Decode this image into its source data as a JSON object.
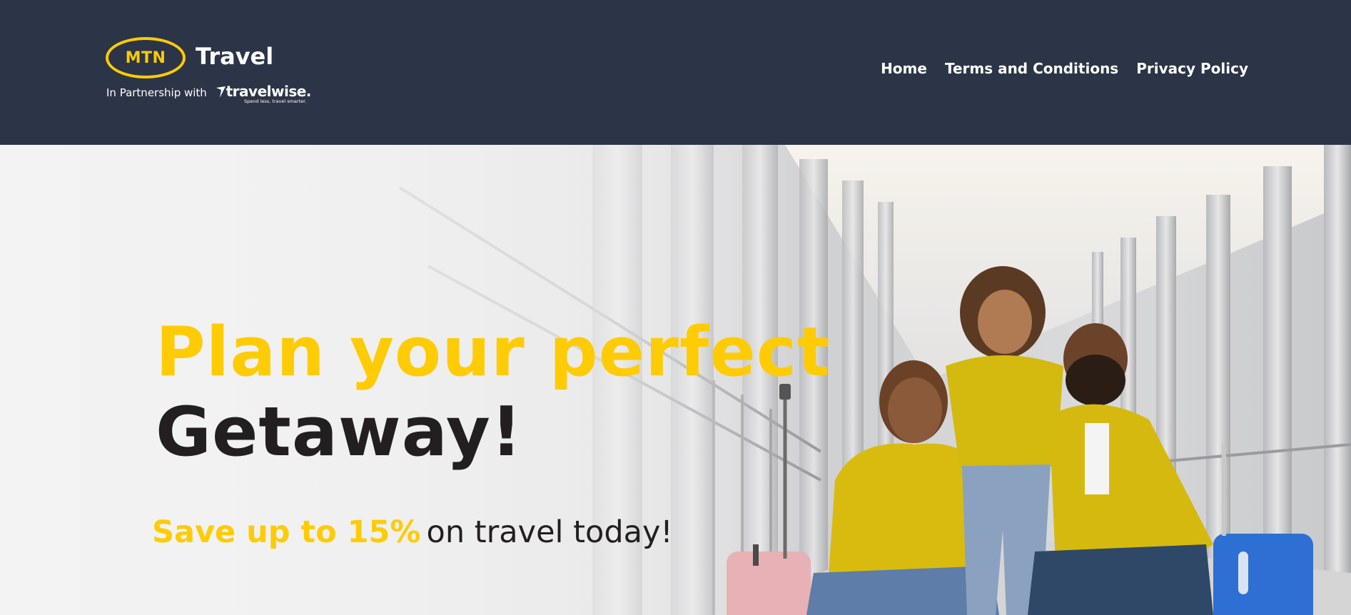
{
  "brand": {
    "mtn_mark": "MTN",
    "product_name": "Travel",
    "partnership_text": "In Partnership with",
    "partner_name": "travelwise.",
    "partner_tagline": "Spend less, travel smarter.",
    "colors": {
      "header_bg": "#2b3547",
      "mtn_yellow": "#ffcb05",
      "text_dark": "#231f20"
    }
  },
  "nav": {
    "items": [
      {
        "label": "Home"
      },
      {
        "label": "Terms and Conditions"
      },
      {
        "label": "Privacy Policy"
      }
    ]
  },
  "hero": {
    "headline_line1": "Plan your perfect",
    "headline_line2": "Getaway!",
    "sub_highlight": "Save up to 15%",
    "sub_rest": "on travel today!",
    "image_icon": "family-airport-photo"
  }
}
